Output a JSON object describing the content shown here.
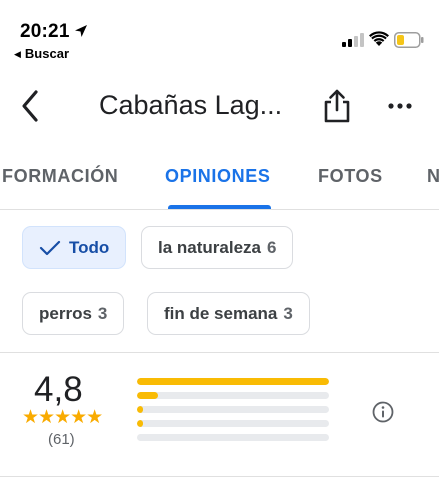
{
  "status_bar": {
    "time": "20:21",
    "back_app_label": "Buscar",
    "icons": [
      "location-arrow-icon",
      "cellular-signal-icon",
      "wifi-icon",
      "battery-low-icon"
    ],
    "battery_color": "#f5c518"
  },
  "header": {
    "title": "Cabañas Lag...",
    "icons": [
      "back-arrow-icon",
      "share-icon",
      "more-vert-icon"
    ]
  },
  "tabs": [
    {
      "label": "FORMACIÓN",
      "active": false
    },
    {
      "label": "OPINIONES",
      "active": true
    },
    {
      "label": "FOTOS",
      "active": false
    },
    {
      "label": "N",
      "active": false
    }
  ],
  "chips": [
    {
      "label": "Todo",
      "count": "",
      "selected": true
    },
    {
      "label": "la naturaleza",
      "count": "6",
      "selected": false
    },
    {
      "label": "perros",
      "count": "3",
      "selected": false
    },
    {
      "label": "fin de semana",
      "count": "3",
      "selected": false
    }
  ],
  "rating": {
    "value": "4,8",
    "stars": "★★★★★",
    "count": "(61)",
    "distribution": [
      {
        "stars": 5,
        "fraction": 1.0
      },
      {
        "stars": 4,
        "fraction": 0.11
      },
      {
        "stars": 3,
        "fraction": 0.03
      },
      {
        "stars": 2,
        "fraction": 0.01
      },
      {
        "stars": 1,
        "fraction": 0.0
      }
    ]
  },
  "colors": {
    "accent": "#1a73e8",
    "bar_fill": "#f9bb04",
    "bar_track": "#e8eaed",
    "star": "#f9ab00",
    "chip_selected_bg": "#e8f0fe"
  }
}
